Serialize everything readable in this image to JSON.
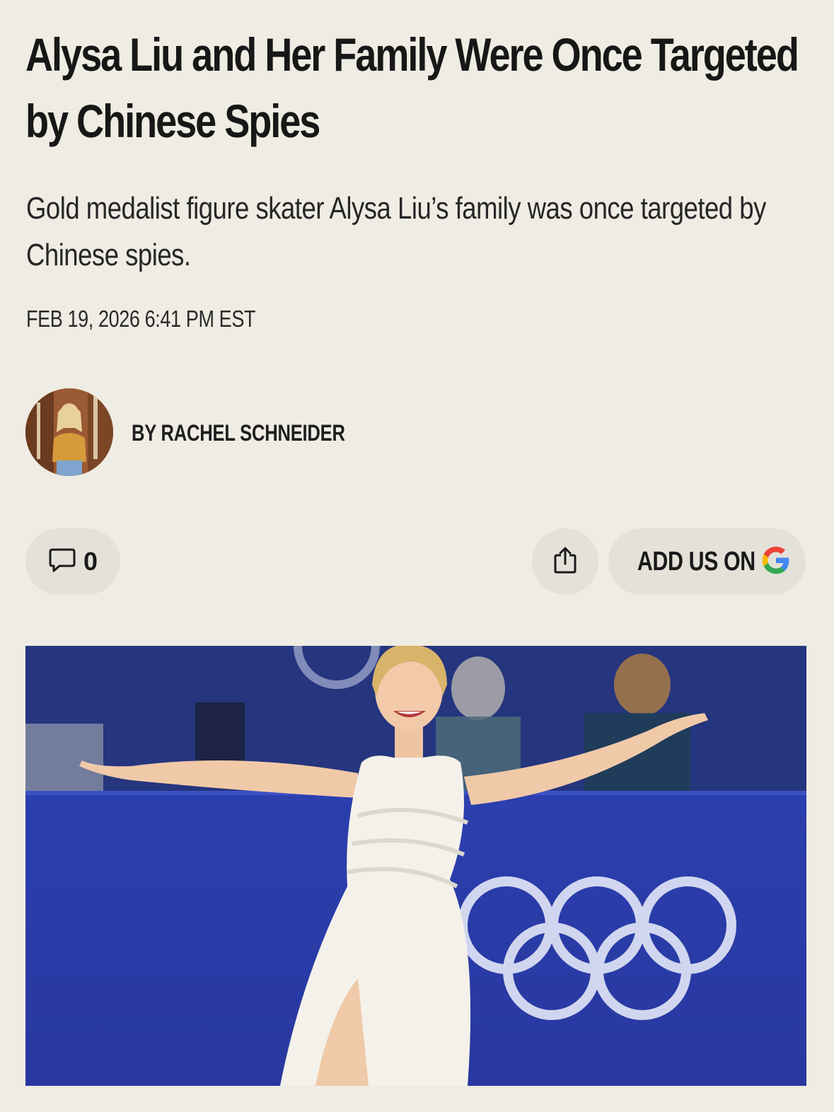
{
  "article": {
    "headline": "Alysa Liu and Her Family Were Once Targeted by Chinese Spies",
    "dek": "Gold medalist figure skater Alysa Liu’s family was once targeted by Chinese spies.",
    "timestamp": "FEB 19, 2026 6:41 PM EST",
    "byline": "BY RACHEL SCHNEIDER"
  },
  "actions": {
    "comment_count": "0",
    "add_us_label": "ADD US ON",
    "comment_icon": "comment-bubble-icon",
    "share_icon": "share-icon",
    "google_icon": "google-g-icon"
  },
  "colors": {
    "page_background": "#efece3",
    "pill_background": "#e4e1d8",
    "hero_blue": "#2a3ea0"
  }
}
